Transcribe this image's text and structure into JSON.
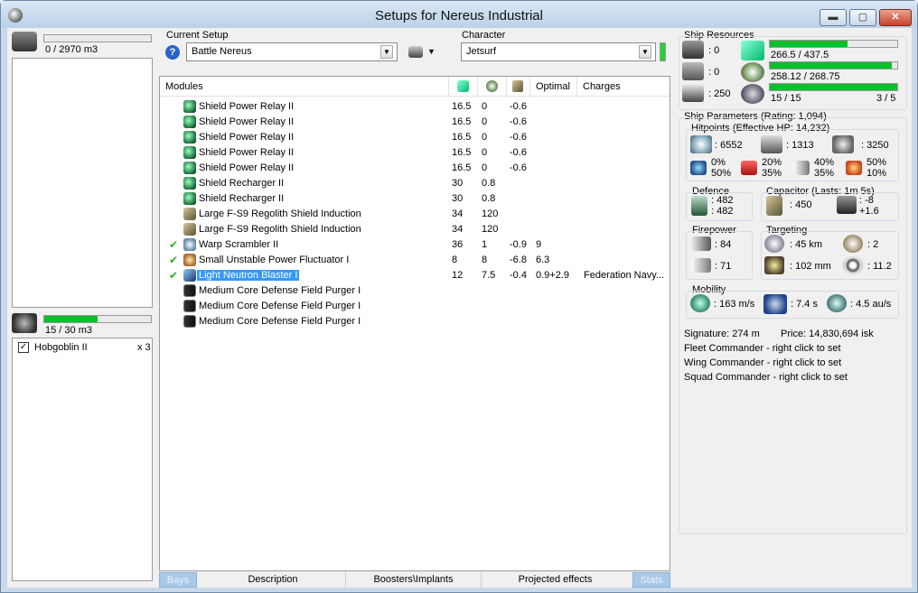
{
  "window": {
    "title": "Setups for Nereus Industrial",
    "min": "▬",
    "max": "▢",
    "close": "✕"
  },
  "cargo": {
    "value": "0 / 2970 m3",
    "fill": 0.0
  },
  "drones": {
    "value": "15 / 30 m3",
    "fill": 0.5,
    "items": [
      {
        "name": "Hobgoblin II",
        "count": "x 3",
        "checked": true
      }
    ]
  },
  "current_setup": {
    "label": "Current Setup",
    "value": "Battle Nereus",
    "help": "?"
  },
  "character": {
    "label": "Character",
    "value": "Jetsurf"
  },
  "modules": {
    "headers": {
      "name": "Modules",
      "optimal": "Optimal",
      "charges": "Charges"
    },
    "rows": [
      {
        "name": "Shield Power Relay II",
        "icon": "shield-relay-icon",
        "cpu": "16.5",
        "pg": "0",
        "cal": "-0.6",
        "optimal": "",
        "charges": "",
        "active": false,
        "selected": false
      },
      {
        "name": "Shield Power Relay II",
        "icon": "shield-relay-icon",
        "cpu": "16.5",
        "pg": "0",
        "cal": "-0.6",
        "optimal": "",
        "charges": "",
        "active": false,
        "selected": false
      },
      {
        "name": "Shield Power Relay II",
        "icon": "shield-relay-icon",
        "cpu": "16.5",
        "pg": "0",
        "cal": "-0.6",
        "optimal": "",
        "charges": "",
        "active": false,
        "selected": false
      },
      {
        "name": "Shield Power Relay II",
        "icon": "shield-relay-icon",
        "cpu": "16.5",
        "pg": "0",
        "cal": "-0.6",
        "optimal": "",
        "charges": "",
        "active": false,
        "selected": false
      },
      {
        "name": "Shield Power Relay II",
        "icon": "shield-relay-icon",
        "cpu": "16.5",
        "pg": "0",
        "cal": "-0.6",
        "optimal": "",
        "charges": "",
        "active": false,
        "selected": false
      },
      {
        "name": "Shield Recharger II",
        "icon": "shield-recharger-icon",
        "cpu": "30",
        "pg": "0.8",
        "cal": "",
        "optimal": "",
        "charges": "",
        "active": false,
        "selected": false
      },
      {
        "name": "Shield Recharger II",
        "icon": "shield-recharger-icon",
        "cpu": "30",
        "pg": "0.8",
        "cal": "",
        "optimal": "",
        "charges": "",
        "active": false,
        "selected": false
      },
      {
        "name": "Large F-S9 Regolith Shield Induction",
        "icon": "shield-extender-icon",
        "cpu": "34",
        "pg": "120",
        "cal": "",
        "optimal": "",
        "charges": "",
        "active": false,
        "selected": false
      },
      {
        "name": "Large F-S9 Regolith Shield Induction",
        "icon": "shield-extender-icon",
        "cpu": "34",
        "pg": "120",
        "cal": "",
        "optimal": "",
        "charges": "",
        "active": false,
        "selected": false
      },
      {
        "name": "Warp Scrambler II",
        "icon": "warp-scrambler-icon",
        "cpu": "36",
        "pg": "1",
        "cal": "-0.9",
        "optimal": "9",
        "charges": "",
        "active": true,
        "selected": false
      },
      {
        "name": "Small Unstable Power Fluctuator I",
        "icon": "power-fluctuator-icon",
        "cpu": "8",
        "pg": "8",
        "cal": "-6.8",
        "optimal": "6.3",
        "charges": "",
        "active": true,
        "selected": false
      },
      {
        "name": "Light Neutron Blaster I",
        "icon": "blaster-icon",
        "cpu": "12",
        "pg": "7.5",
        "cal": "-0.4",
        "optimal": "0.9+2.9",
        "charges": "Federation Navy...",
        "active": true,
        "selected": true
      },
      {
        "name": "Medium Core Defense Field Purger I",
        "icon": "rig-icon",
        "cpu": "",
        "pg": "",
        "cal": "",
        "optimal": "",
        "charges": "",
        "active": false,
        "selected": false
      },
      {
        "name": "Medium Core Defense Field Purger I",
        "icon": "rig-icon",
        "cpu": "",
        "pg": "",
        "cal": "",
        "optimal": "",
        "charges": "",
        "active": false,
        "selected": false
      },
      {
        "name": "Medium Core Defense Field Purger I",
        "icon": "rig-icon",
        "cpu": "",
        "pg": "",
        "cal": "",
        "optimal": "",
        "charges": "",
        "active": false,
        "selected": false
      }
    ]
  },
  "tabs": {
    "bays": "Bays",
    "description": "Description",
    "boosters": "Boosters\\Implants",
    "projected": "Projected effects",
    "stats": "Stats"
  },
  "resources": {
    "label": "Ship Resources",
    "hi": ": 0",
    "med": ": 0",
    "low": ": 250",
    "cpu": {
      "text": "266.5 / 437.5",
      "fill": 0.609
    },
    "pg": {
      "text": "258.12 / 268.75",
      "fill": 0.96
    },
    "calibration": {
      "text": "15 / 15",
      "fill": 1.0
    },
    "rigs": "3 / 5"
  },
  "params": {
    "label": "Ship Parameters (Rating: 1,094)",
    "hitpoints": {
      "label": "Hitpoints (Effective HP: 14,232)",
      "shield": ": 6552",
      "armor": ": 1313",
      "structure": ": 3250",
      "em": [
        "0%",
        "50%"
      ],
      "thermal": [
        "20%",
        "35%"
      ],
      "kinetic": [
        "40%",
        "35%"
      ],
      "explosive": [
        "50%",
        "10%"
      ]
    },
    "defence": {
      "label": "Defence",
      "a": ": 482",
      "b": ": 482"
    },
    "capacitor": {
      "label": "Capacitor (Lasts: 1m 5s)",
      "cap": ": 450",
      "use": ": -8",
      "recharge": "+1.6"
    },
    "firepower": {
      "label": "Firepower",
      "dps": ": 84",
      "volley": ": 71"
    },
    "targeting": {
      "label": "Targeting",
      "range": ": 45 km",
      "targets": ": 2",
      "scan": ": 102 mm",
      "sensor": ": 11.2"
    },
    "mobility": {
      "label": "Mobility",
      "speed": ": 163 m/s",
      "align": ": 7.4 s",
      "warp": ": 4.5 au/s"
    },
    "signature": "Signature: 274 m",
    "price": "Price: 14,830,694 isk",
    "fleet": "Fleet Commander - right click to set",
    "wing": "Wing Commander - right click to set",
    "squad": "Squad Commander - right click to set"
  }
}
